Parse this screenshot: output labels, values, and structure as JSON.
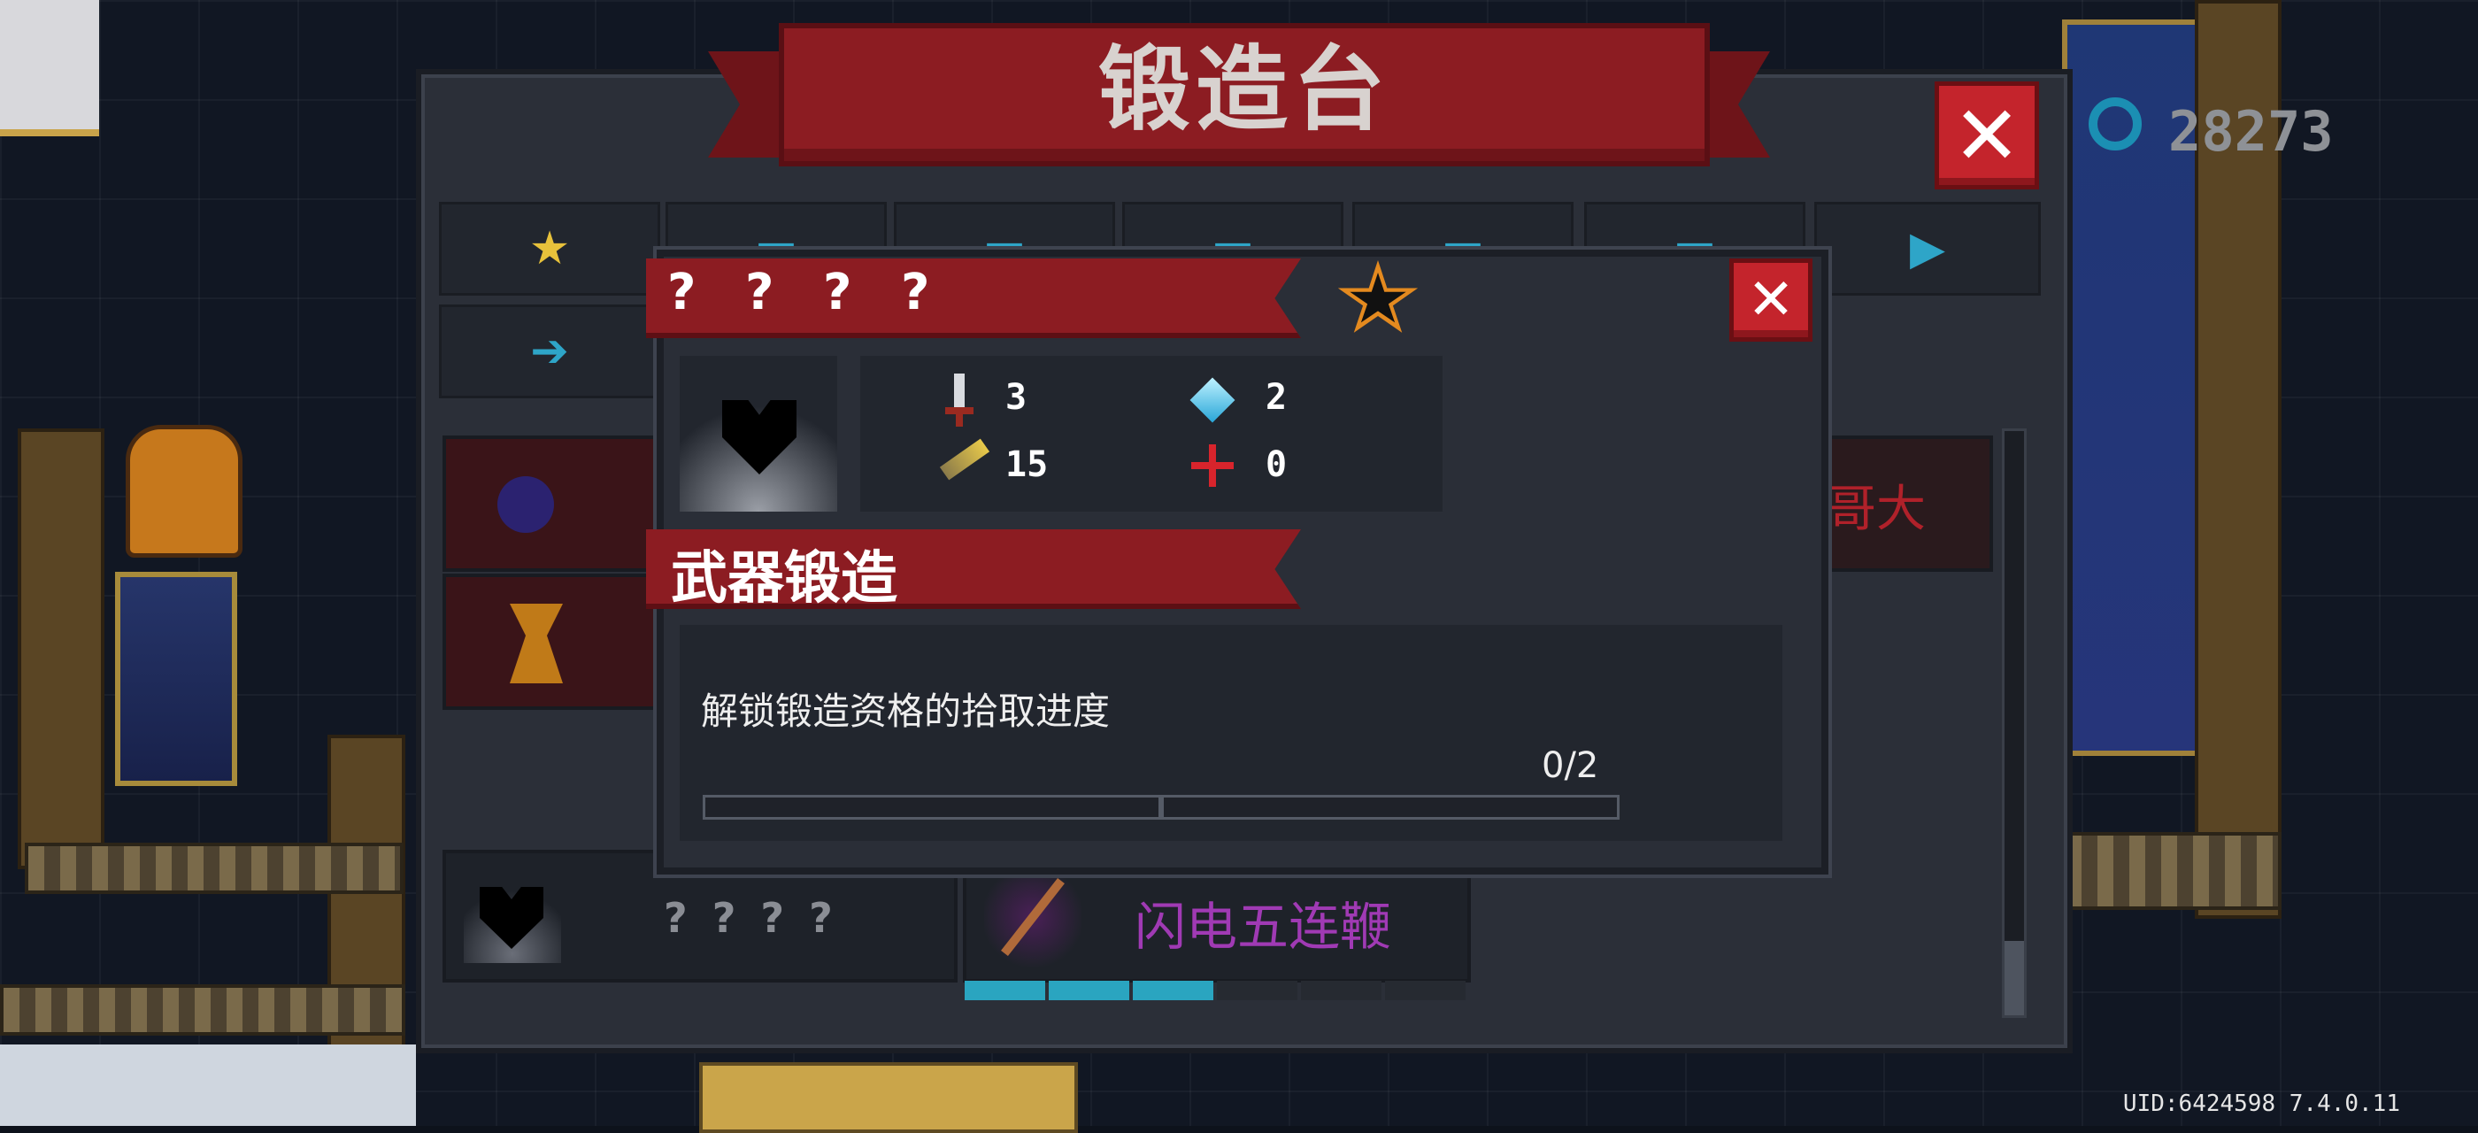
{
  "title": "锻造台",
  "currency": {
    "value": "28273",
    "icon": "gem-coin-icon"
  },
  "tabs": [
    {
      "icon": "star-icon",
      "label": "★"
    },
    {
      "icon": "gun-icon",
      "label": "▬"
    },
    {
      "icon": "rifle-icon",
      "label": "▬"
    },
    {
      "icon": "pistol-icon",
      "label": "▬"
    },
    {
      "icon": "sniper-icon",
      "label": "▬"
    },
    {
      "icon": "launcher-icon",
      "label": "▬"
    },
    {
      "icon": "drill-gun-icon",
      "label": "▶"
    },
    {
      "icon": "arrow-weapon-icon",
      "label": "➔"
    }
  ],
  "bg_list": {
    "partial_text": "哥大",
    "bottom_unknown_name": "? ? ? ?",
    "bottom_weapon_name": "闪电五连鞭"
  },
  "dialog": {
    "name": "? ? ? ?",
    "stats": [
      {
        "icon": "sword-icon",
        "value": "3"
      },
      {
        "icon": "diamond-icon",
        "value": "2"
      },
      {
        "icon": "feather-icon",
        "value": "15"
      },
      {
        "icon": "crosshair-icon",
        "value": "0"
      }
    ],
    "section_title": "武器锻造",
    "progress_label": "解锁锻造资格的拾取进度",
    "progress_text": "0/2",
    "progress_fraction": 0
  },
  "uid": "UID:6424598 7.4.0.11",
  "colors": {
    "banner": "#8c1c22",
    "close": "#c4242c",
    "accent_blue": "#2ea5c8",
    "gold": "#e7c13b",
    "purple_name": "#a03ab4"
  }
}
